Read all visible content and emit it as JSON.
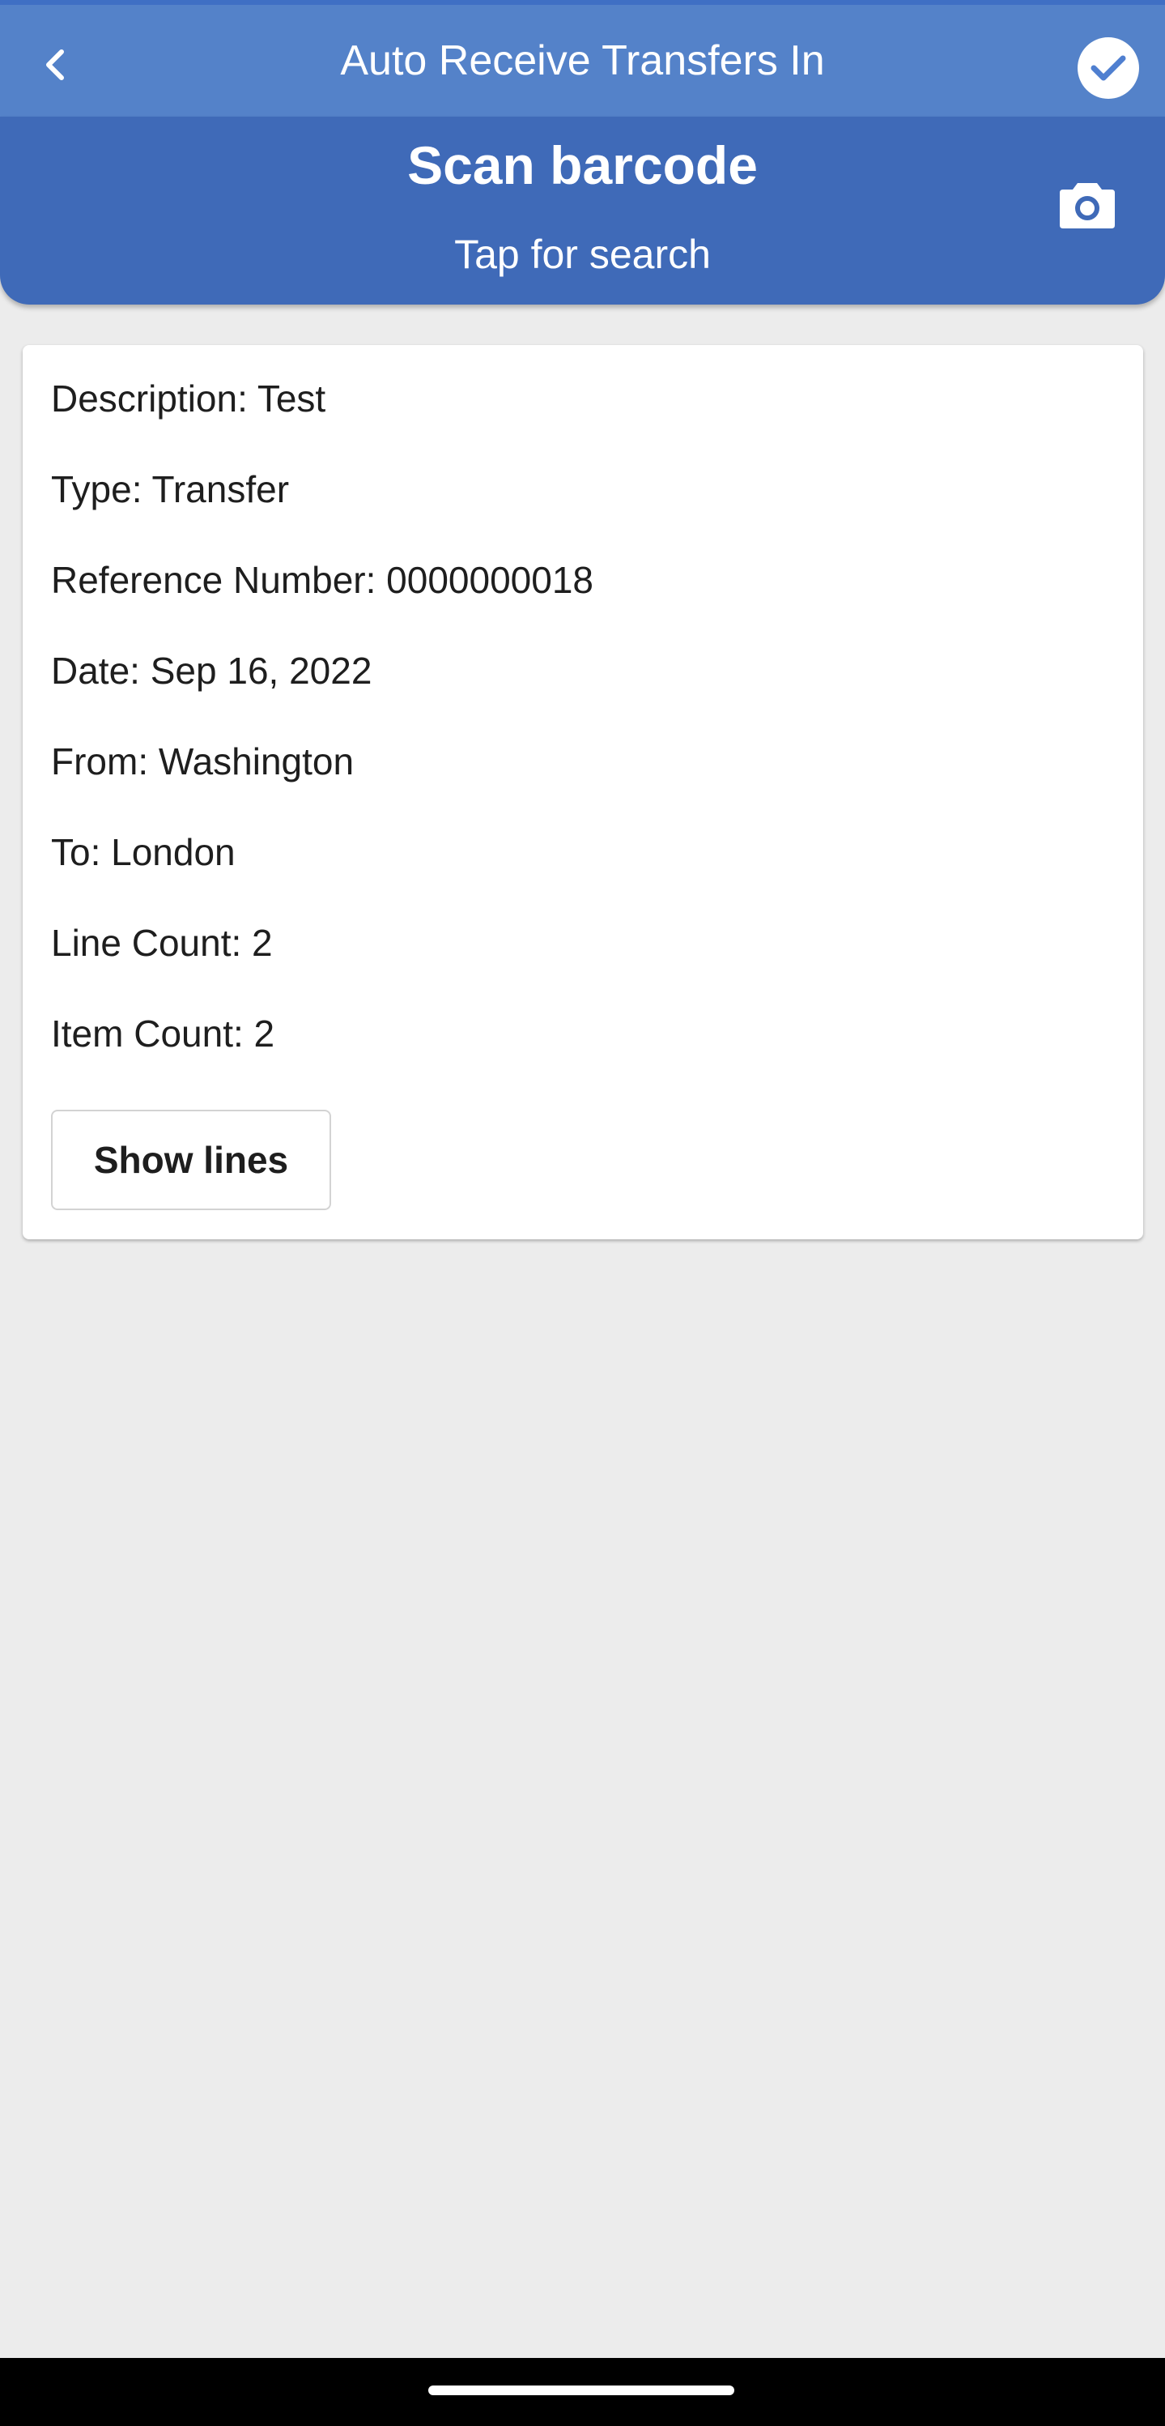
{
  "app_bar": {
    "title": "Auto Receive Transfers In",
    "back_icon": "chevron-left-icon",
    "confirm_icon": "check-circle-icon"
  },
  "scan_header": {
    "title": "Scan barcode",
    "subtitle": "Tap for search",
    "camera_icon": "camera-icon"
  },
  "details": {
    "description": "Description: Test",
    "type": "Type: Transfer",
    "reference_number": "Reference Number: 0000000018",
    "date": "Date: Sep 16, 2022",
    "from": "From: Washington",
    "to": "To: London",
    "line_count": "Line Count: 2",
    "item_count": "Item Count: 2",
    "show_lines_label": "Show lines"
  },
  "colors": {
    "app_bar": "#5482c9",
    "scan_header": "#3f6ab8",
    "background": "#ececec"
  }
}
